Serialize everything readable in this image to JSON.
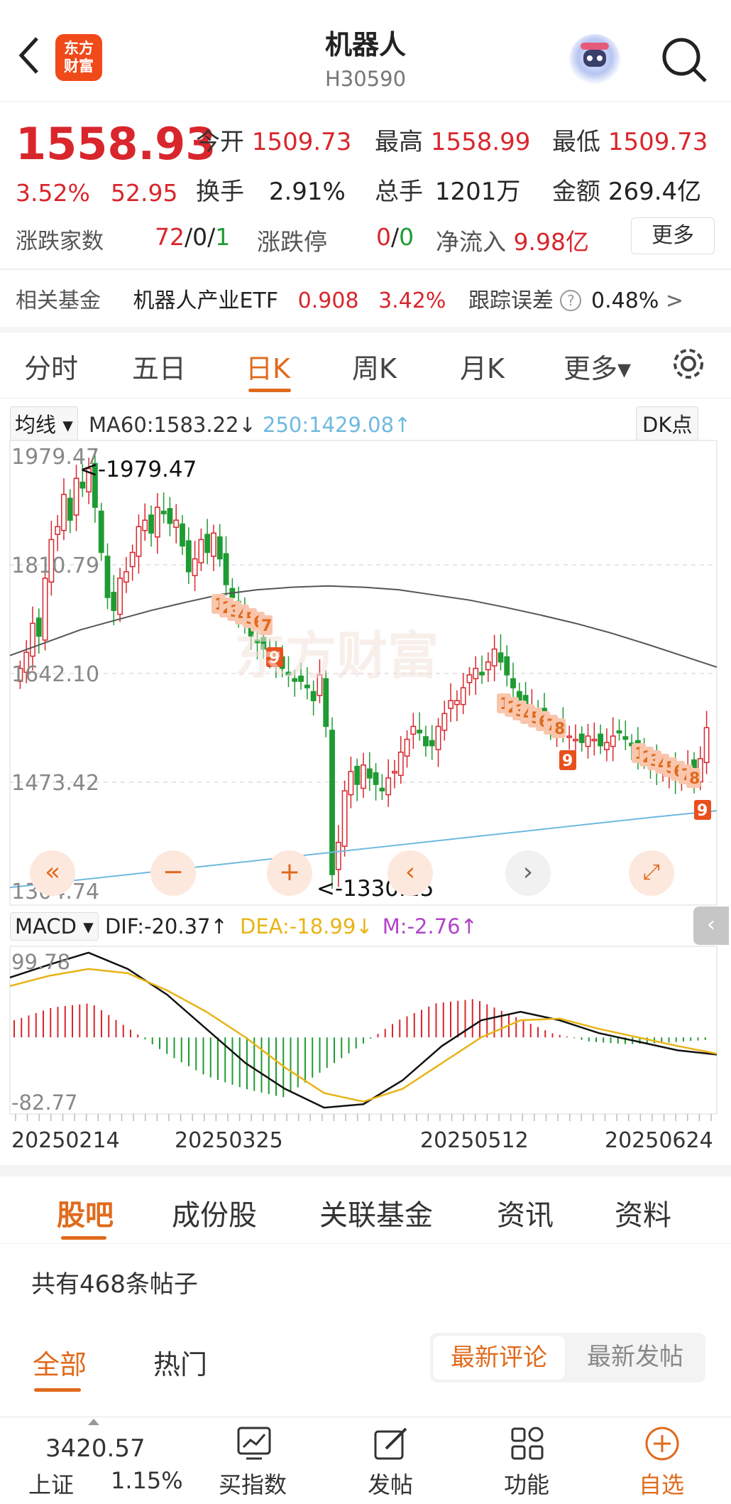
{
  "header": {
    "title": "机器人",
    "code": "H30590",
    "logo": "东方\n财富"
  },
  "quote": {
    "price": "1558.93",
    "change_pct": "3.52%",
    "change": "52.95",
    "open_label": "今开",
    "open": "1509.73",
    "high_label": "最高",
    "high": "1558.99",
    "low_label": "最低",
    "low": "1509.73",
    "turnover_label": "换手",
    "turnover": "2.91%",
    "volume_label": "总手",
    "volume": "1201万",
    "amount_label": "金额",
    "amount": "269.4亿",
    "breadth_label": "涨跌家数",
    "breadth_up": "72",
    "breadth_sep1": "/",
    "breadth_flat": "0",
    "breadth_sep2": "/",
    "breadth_down": "1",
    "limit_label": "涨跌停",
    "limit_up": "0",
    "limit_sep": "/",
    "limit_down": "0",
    "inflow_label": "净流入",
    "inflow": "9.98亿",
    "more": "更多"
  },
  "fund": {
    "label": "相关基金",
    "name": "机器人产业ETF",
    "price": "0.908",
    "pct": "3.42%",
    "err_label": "跟踪误差",
    "err_q": "?",
    "err": "0.48%",
    "arrow": ">"
  },
  "tabs": [
    "分时",
    "五日",
    "日K",
    "周K",
    "月K",
    "更多▾"
  ],
  "active_tab": 2,
  "indicators": {
    "ma_select": "均线",
    "ma60": "MA60:1583.22↓",
    "ma250": "250:1429.08↑",
    "dk": "DK点"
  },
  "macd_row": {
    "select": "MACD",
    "dif": "DIF:-20.37↑",
    "dea": "DEA:-18.99↓",
    "m": "M:-2.76↑",
    "collapse": "‹"
  },
  "chart_data": {
    "type": "candlestick",
    "y_ticks": [
      "1979.47",
      "1810.79",
      "1642.10",
      "1473.42",
      "1304.74"
    ],
    "ylim": [
      1304.74,
      1979.47
    ],
    "high_label": "<-1979.47",
    "low_label": "<-1330.15",
    "x_ticks": [
      "20250214",
      "20250325",
      "20250512",
      "20250624"
    ],
    "dk_markers": [
      "1",
      "2",
      "3",
      "4",
      "5",
      "6",
      "7",
      "9",
      "1",
      "2",
      "3",
      "4",
      "5",
      "6",
      "7",
      "8",
      "9",
      "1",
      "2",
      "3",
      "4",
      "5",
      "6",
      "7",
      "8",
      "9"
    ],
    "closes": [
      1650,
      1675,
      1720,
      1700,
      1790,
      1850,
      1870,
      1920,
      1880,
      1945,
      1930,
      1960,
      1900,
      1830,
      1760,
      1740,
      1790,
      1800,
      1830,
      1870,
      1880,
      1860,
      1900,
      1890,
      1875,
      1880,
      1840,
      1800,
      1820,
      1850,
      1830,
      1860,
      1820,
      1780,
      1760,
      1740,
      1720,
      1700,
      1690,
      1680,
      1670,
      1660,
      1650,
      1640,
      1630,
      1630,
      1620,
      1600,
      1640,
      1560,
      1330,
      1380,
      1460,
      1490,
      1470,
      1500,
      1480,
      1470,
      1460,
      1480,
      1490,
      1520,
      1540,
      1560,
      1550,
      1530,
      1530,
      1560,
      1580,
      1600,
      1600,
      1620,
      1640,
      1650,
      1640,
      1660,
      1680,
      1660,
      1640,
      1620,
      1600,
      1595,
      1590,
      1580,
      1570,
      1560,
      1555,
      1550,
      1545,
      1540,
      1535,
      1545,
      1540,
      1530,
      1535,
      1545,
      1550,
      1540,
      1530,
      1520,
      1510,
      1500,
      1495,
      1490,
      1485,
      1480,
      1490,
      1500,
      1480,
      1510,
      1558
    ],
    "ma60": [
      1670,
      1690,
      1710,
      1725,
      1740,
      1753,
      1765,
      1772,
      1776,
      1778,
      1776,
      1772,
      1764,
      1756,
      1745,
      1733,
      1720,
      1705,
      1688,
      1670,
      1652
    ],
    "ma250": [
      1310,
      1320,
      1330,
      1340,
      1350,
      1360,
      1370,
      1380,
      1390,
      1400,
      1410,
      1420,
      1429
    ],
    "macd_ylabels": [
      "99.78",
      "-82.77"
    ],
    "dif": [
      70,
      85,
      99,
      80,
      50,
      10,
      -30,
      -60,
      -82,
      -78,
      -50,
      -10,
      20,
      30,
      20,
      5,
      -5,
      -15,
      -20
    ],
    "dea": [
      60,
      72,
      80,
      75,
      55,
      30,
      0,
      -35,
      -65,
      -75,
      -60,
      -30,
      0,
      20,
      22,
      10,
      0,
      -10,
      -19
    ],
    "m": [
      20,
      35,
      40,
      10,
      -20,
      -45,
      -60,
      -70,
      -40,
      -10,
      20,
      40,
      45,
      25,
      5,
      -5,
      -8,
      -6,
      -3
    ]
  },
  "bottom_tabs": [
    "股吧",
    "成份股",
    "关联基金",
    "资讯",
    "资料"
  ],
  "posts_count": "共有468条帖子",
  "filter_tabs": [
    "全部",
    "热门"
  ],
  "sort": [
    "最新评论",
    "最新发帖"
  ],
  "bottom_bar": {
    "index_value": "3420.57",
    "index_name": "上证",
    "index_pct": "1.15%",
    "items": [
      "买指数",
      "发帖",
      "功能",
      "自选"
    ]
  },
  "colors": {
    "accent": "#e06a1c",
    "up": "#d8262c",
    "down": "#1f9b33",
    "ma250": "#6fb9e0",
    "dea": "#e8b416",
    "m": "#b044c8"
  }
}
